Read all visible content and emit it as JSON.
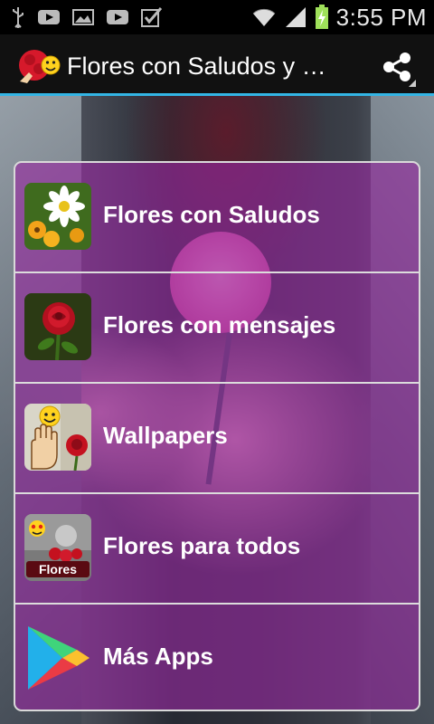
{
  "status_bar": {
    "time": "3:55 PM",
    "icons": [
      "usb-icon",
      "youtube-icon",
      "image-icon",
      "youtube-icon",
      "checkbox-icon",
      "wifi-icon",
      "signal-icon",
      "battery-charging-icon"
    ]
  },
  "action_bar": {
    "title": "Flores con Saludos y M...",
    "share_icon": "share-icon"
  },
  "menu": {
    "items": [
      {
        "label": "Flores con Saludos",
        "icon": "daisy-flower-icon"
      },
      {
        "label": "Flores con mensajes",
        "icon": "red-rose-icon"
      },
      {
        "label": "Wallpapers",
        "icon": "hand-smiley-rose-icon"
      },
      {
        "label": "Flores para todos",
        "icon": "flores-photo-icon"
      },
      {
        "label": "Más Apps",
        "icon": "play-store-icon"
      }
    ]
  },
  "colors": {
    "menu_overlay": "#9628a0",
    "action_bar_divider": "#33b5e5",
    "status_bar": "#000000"
  }
}
